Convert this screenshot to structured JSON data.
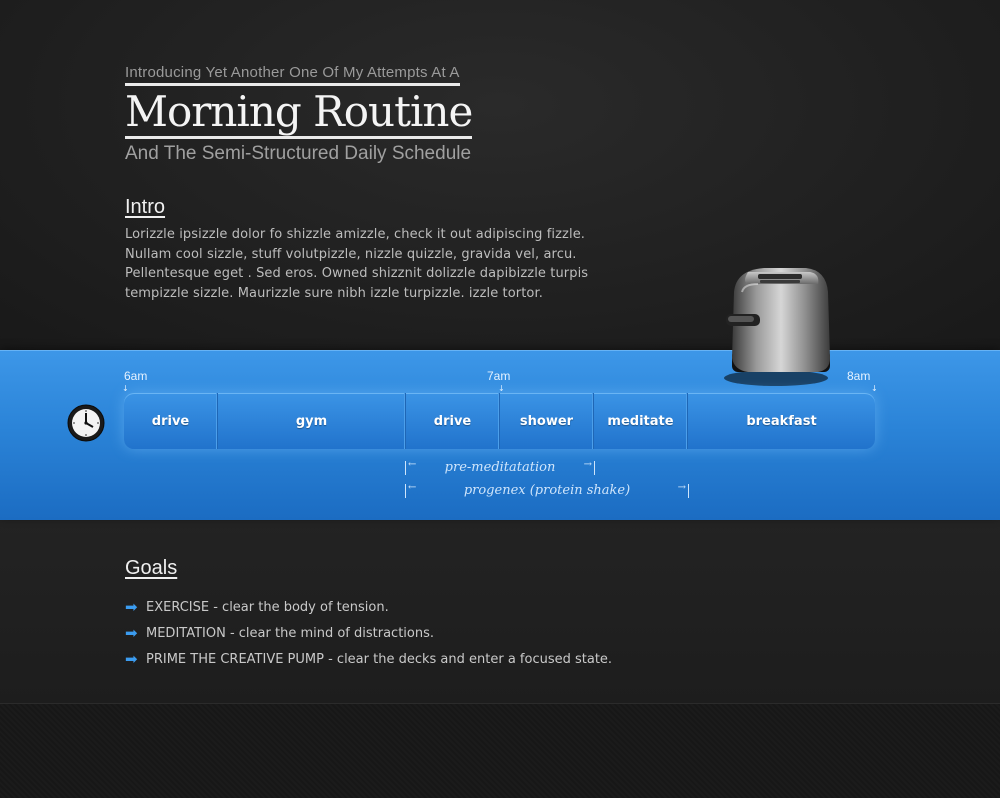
{
  "header": {
    "intro_line": "Introducing Yet Another One Of My Attempts At A",
    "title": "Morning Routine",
    "subtitle": "And The Semi-Structured Daily Schedule"
  },
  "intro": {
    "heading": "Intro",
    "text": "Lorizzle ipsizzle dolor fo shizzle amizzle, check it out adipiscing fizzle. Nullam cool sizzle, stuff volutpizzle, nizzle quizzle, gravida vel, arcu. Pellentesque eget . Sed eros. Owned shizznit dolizzle dapibizzle turpis tempizzle sizzle. Maurizzle sure nibh izzle turpizzle. izzle tortor."
  },
  "schedule": {
    "times": [
      "6am",
      "7am",
      "8am"
    ],
    "blocks": [
      {
        "label": "drive"
      },
      {
        "label": "gym"
      },
      {
        "label": "drive"
      },
      {
        "label": "shower"
      },
      {
        "label": "meditate"
      },
      {
        "label": "breakfast"
      }
    ],
    "spans": [
      {
        "label": "pre-meditatation"
      },
      {
        "label": "progenex (protein shake)"
      }
    ]
  },
  "goals": {
    "heading": "Goals",
    "items": [
      "EXERCISE - clear the body of tension.",
      "MEDITATION - clear the mind of distractions.",
      "PRIME THE CREATIVE PUMP - clear the decks and enter a focused state."
    ]
  },
  "colors": {
    "band_blue": "#2b84d8",
    "goal_arrow": "#3b9cf0",
    "background": "#1f1f1f"
  },
  "icons": [
    "clock-icon",
    "toaster-icon",
    "arrow-right-icon"
  ]
}
